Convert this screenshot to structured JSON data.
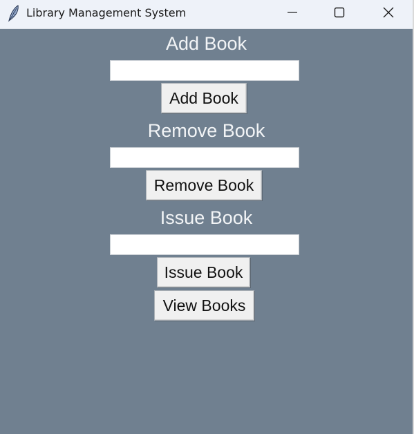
{
  "window": {
    "title": "Library Management System",
    "app_icon": "feather-icon",
    "controls": [
      "minimize-icon",
      "maximize-icon",
      "close-icon"
    ]
  },
  "theme": {
    "background": "#708090",
    "label_color": "#f2f4f6",
    "button_face": "#f0f0f0",
    "titlebar": "#eef2f9"
  },
  "form": {
    "add": {
      "label": "Add Book",
      "input_value": "",
      "button": "Add Book"
    },
    "remove": {
      "label": "Remove Book",
      "input_value": "",
      "button": "Remove Book"
    },
    "issue": {
      "label": "Issue Book",
      "input_value": "",
      "button": "Issue Book"
    },
    "view_button": "View Books"
  }
}
